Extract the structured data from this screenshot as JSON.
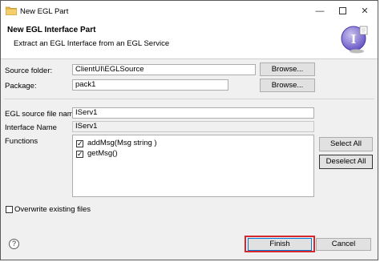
{
  "window": {
    "title": "New EGL Part",
    "minimize_icon": "minimize-icon",
    "maximize_icon": "maximize-icon",
    "close_icon": "close-icon"
  },
  "banner": {
    "title": "New EGL Interface Part",
    "description": "Extract an EGL Interface from an EGL Service",
    "graphic_icon": "interface-wizard-icon"
  },
  "form": {
    "source_folder_label": "Source folder:",
    "source_folder_value": "ClientUI\\EGLSource",
    "source_folder_browse": "Browse...",
    "package_label": "Package:",
    "package_value": "pack1",
    "package_browse": "Browse...",
    "file_name_label": "EGL source file name:",
    "file_name_value": "IServ1",
    "interface_name_label": "Interface Name",
    "interface_name_value": "IServ1",
    "functions_label": "Functions",
    "functions": [
      {
        "label": "addMsg(Msg string )",
        "checked": true
      },
      {
        "label": "getMsg()",
        "checked": true
      }
    ],
    "select_all": "Select All",
    "deselect_all": "Deselect All",
    "overwrite_label": "Overwrite existing files",
    "overwrite_checked": false
  },
  "footer": {
    "help_icon": "help-icon",
    "finish": "Finish",
    "cancel": "Cancel"
  },
  "colors": {
    "highlight": "#d7262c",
    "dialog_background": "#f0f0f0"
  }
}
